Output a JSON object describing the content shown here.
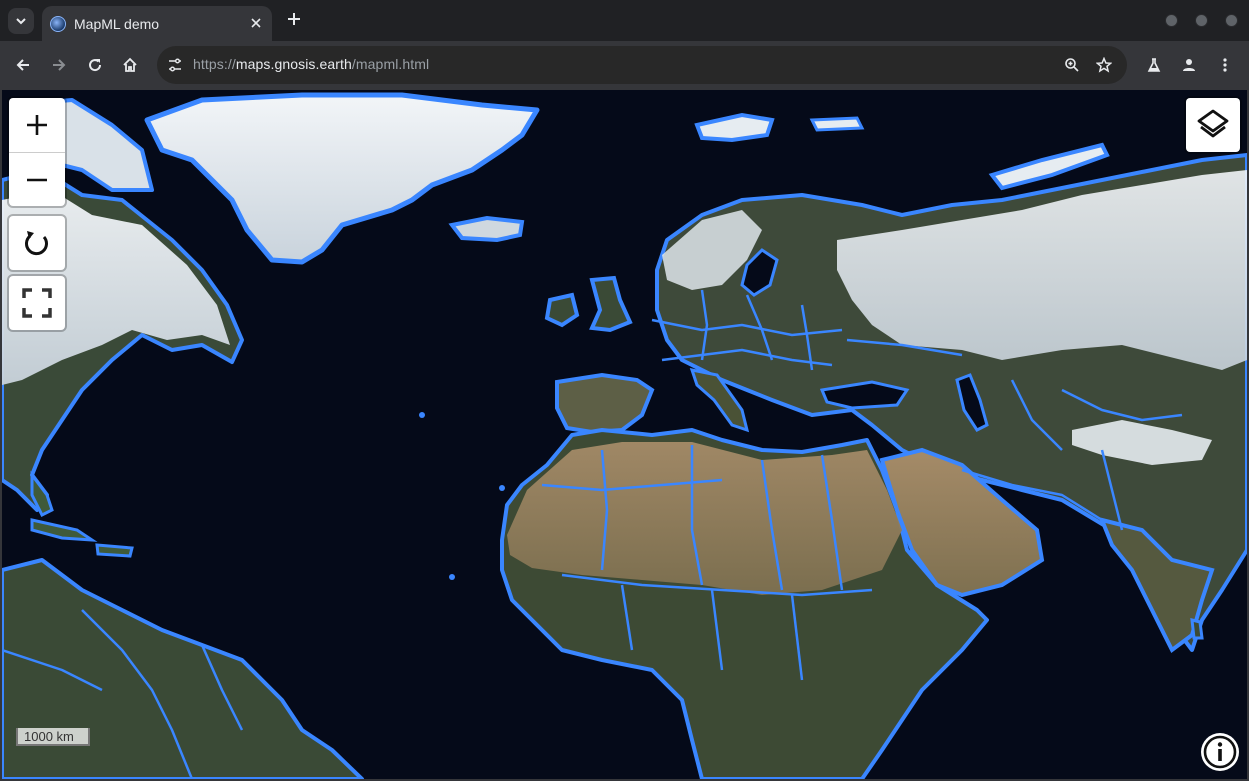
{
  "tab": {
    "title": "MapML demo"
  },
  "toolbar": {
    "url_scheme": "https://",
    "url_host": "maps.gnosis.earth",
    "url_path": "/mapml.html"
  },
  "map": {
    "scale_label": "1000 km",
    "colors": {
      "ocean": "#050a19",
      "land": "#3d4a36",
      "desert": "#a08a6a",
      "snow": "#e8edf2",
      "border": "#3a86ff"
    }
  },
  "icons": {
    "tab_search": "chevron-down-icon",
    "new_tab": "plus-icon",
    "back": "arrow-left-icon",
    "forward": "arrow-right-icon",
    "reload": "reload-icon",
    "home": "home-icon",
    "site_info": "tune-icon",
    "zoom": "zoom-icon",
    "bookmark": "star-icon",
    "labs": "flask-icon",
    "profile": "person-icon",
    "menu": "kebab-menu-icon",
    "map_zoom_in": "plus-icon",
    "map_zoom_out": "minus-icon",
    "map_reload": "reload-icon",
    "map_fullscreen": "fullscreen-icon",
    "map_layers": "layers-icon",
    "map_info": "info-icon"
  }
}
